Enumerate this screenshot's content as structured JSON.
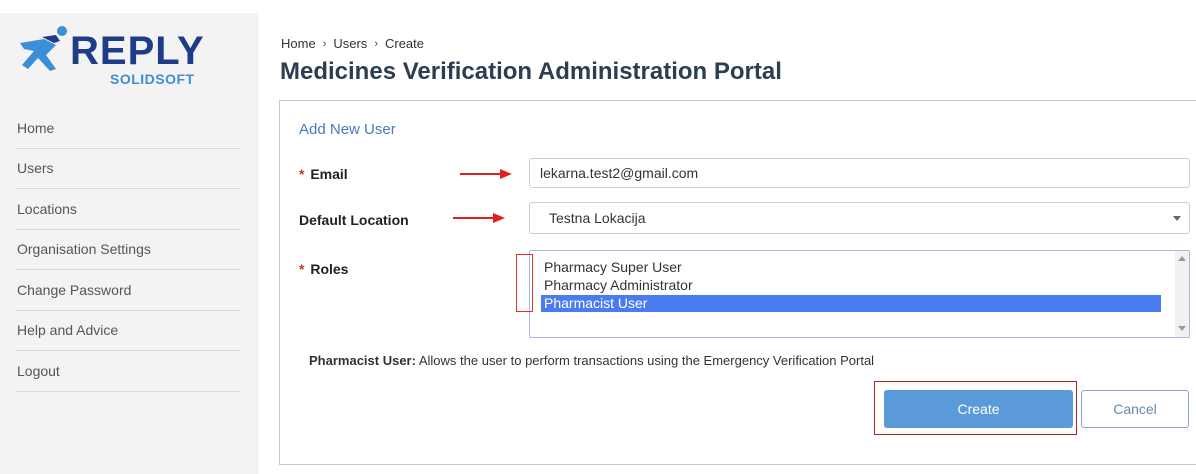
{
  "brand": {
    "name": "REPLY",
    "sub": "SOLIDSOFT",
    "colors": {
      "primary": "#1f3c88",
      "secondary": "#3b8fd6"
    }
  },
  "sidebar": {
    "items": [
      {
        "label": "Home"
      },
      {
        "label": "Users"
      },
      {
        "label": "Locations"
      },
      {
        "label": "Organisation Settings"
      },
      {
        "label": "Change Password"
      },
      {
        "label": "Help and Advice"
      },
      {
        "label": "Logout"
      }
    ]
  },
  "breadcrumb": {
    "items": [
      "Home",
      "Users",
      "Create"
    ],
    "separator": "›"
  },
  "page": {
    "title": "Medicines Verification Administration Portal"
  },
  "form": {
    "title": "Add New User",
    "required_mark": "*",
    "email": {
      "label": "Email",
      "value": "lekarna.test2@gmail.com"
    },
    "location": {
      "label": "Default Location",
      "selected": "Testna Lokacija"
    },
    "roles": {
      "label": "Roles",
      "options": [
        "Pharmacy Super User",
        "Pharmacy Administrator",
        "Pharmacist User"
      ],
      "selected_index": 2
    },
    "role_description": {
      "name": "Pharmacist User:",
      "text": "Allows the user to perform transactions using the Emergency Verification Portal"
    },
    "create_label": "Create",
    "cancel_label": "Cancel"
  },
  "colors": {
    "accent": "#4a7cf0",
    "button": "#5b9ad9",
    "annotation_red": "#d33"
  }
}
